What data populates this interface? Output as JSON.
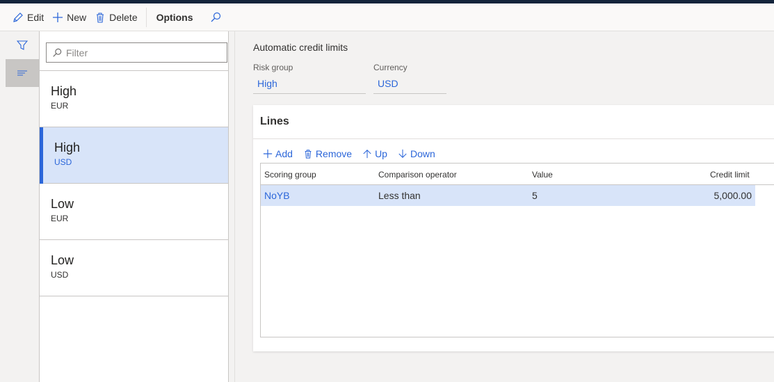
{
  "toolbar": {
    "edit": "Edit",
    "new": "New",
    "delete": "Delete",
    "options": "Options"
  },
  "filter": {
    "placeholder": "Filter"
  },
  "list": [
    {
      "title": "High",
      "sub": "EUR"
    },
    {
      "title": "High",
      "sub": "USD"
    },
    {
      "title": "Low",
      "sub": "EUR"
    },
    {
      "title": "Low",
      "sub": "USD"
    }
  ],
  "detail": {
    "section_title": "Automatic credit limits",
    "risk_group_label": "Risk group",
    "risk_group_value": "High",
    "currency_label": "Currency",
    "currency_value": "USD"
  },
  "lines": {
    "title": "Lines",
    "add": "Add",
    "remove": "Remove",
    "up": "Up",
    "down": "Down",
    "columns": {
      "scoring_group": "Scoring group",
      "comparison_operator": "Comparison operator",
      "value": "Value",
      "credit_limit": "Credit limit"
    },
    "rows": [
      {
        "scoring_group": "NoYB",
        "comparison_operator": "Less than",
        "value": "5",
        "credit_limit": "5,000.00"
      }
    ]
  },
  "colors": {
    "accent": "#2b66d9",
    "selected_bg": "#d8e4f9",
    "topbar": "#13243b"
  }
}
